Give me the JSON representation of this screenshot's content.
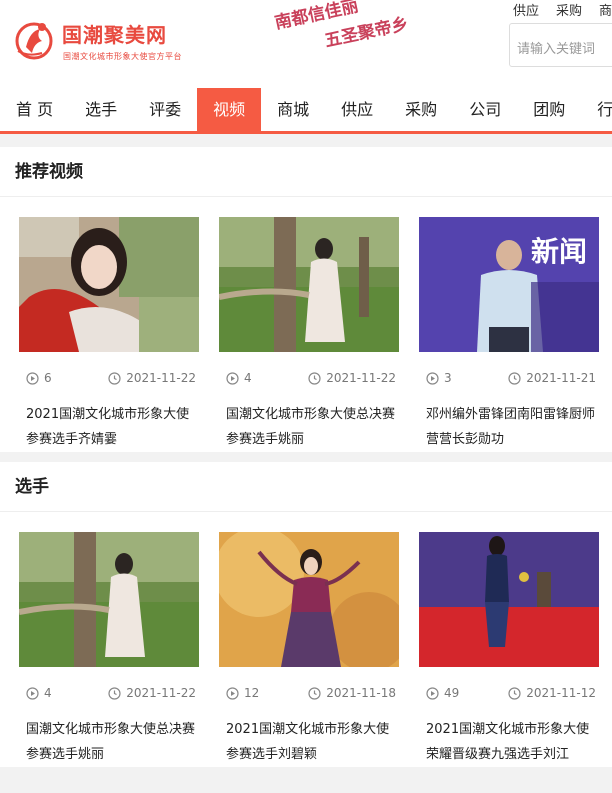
{
  "brand": {
    "title": "国潮聚美网",
    "subtitle": "国潮文化城市形象大使官方平台"
  },
  "slogan": {
    "line1": "南都信佳丽",
    "line2": "五圣聚帝乡"
  },
  "toplinks": [
    "供应",
    "采购",
    "商"
  ],
  "search": {
    "placeholder": "请输入关键词"
  },
  "nav": [
    {
      "label": "首 页",
      "active": false
    },
    {
      "label": "选手",
      "active": false
    },
    {
      "label": "评委",
      "active": false
    },
    {
      "label": "视频",
      "active": true
    },
    {
      "label": "商城",
      "active": false
    },
    {
      "label": "供应",
      "active": false
    },
    {
      "label": "采购",
      "active": false
    },
    {
      "label": "公司",
      "active": false
    },
    {
      "label": "团购",
      "active": false
    },
    {
      "label": "行",
      "active": false
    }
  ],
  "sections": [
    {
      "title": "推荐视频",
      "cards": [
        {
          "views": "6",
          "date": "2021-11-22",
          "title": "2021国潮文化城市形象大使参赛选手齐婧霎"
        },
        {
          "views": "4",
          "date": "2021-11-22",
          "title": "国潮文化城市形象大使总决赛参赛选手姚丽"
        },
        {
          "views": "3",
          "date": "2021-11-21",
          "title": "邓州编外雷锋团南阳雷锋厨师营营长彭勋功"
        }
      ]
    },
    {
      "title": "选手",
      "cards": [
        {
          "views": "4",
          "date": "2021-11-22",
          "title": "国潮文化城市形象大使总决赛参赛选手姚丽"
        },
        {
          "views": "12",
          "date": "2021-11-18",
          "title": "2021国潮文化城市形象大使参赛选手刘碧颖"
        },
        {
          "views": "49",
          "date": "2021-11-12",
          "title": "2021国潮文化城市形象大使荣耀晋级赛九强选手刘江"
        }
      ]
    }
  ],
  "thumb_text": {
    "banner": "新闻"
  }
}
